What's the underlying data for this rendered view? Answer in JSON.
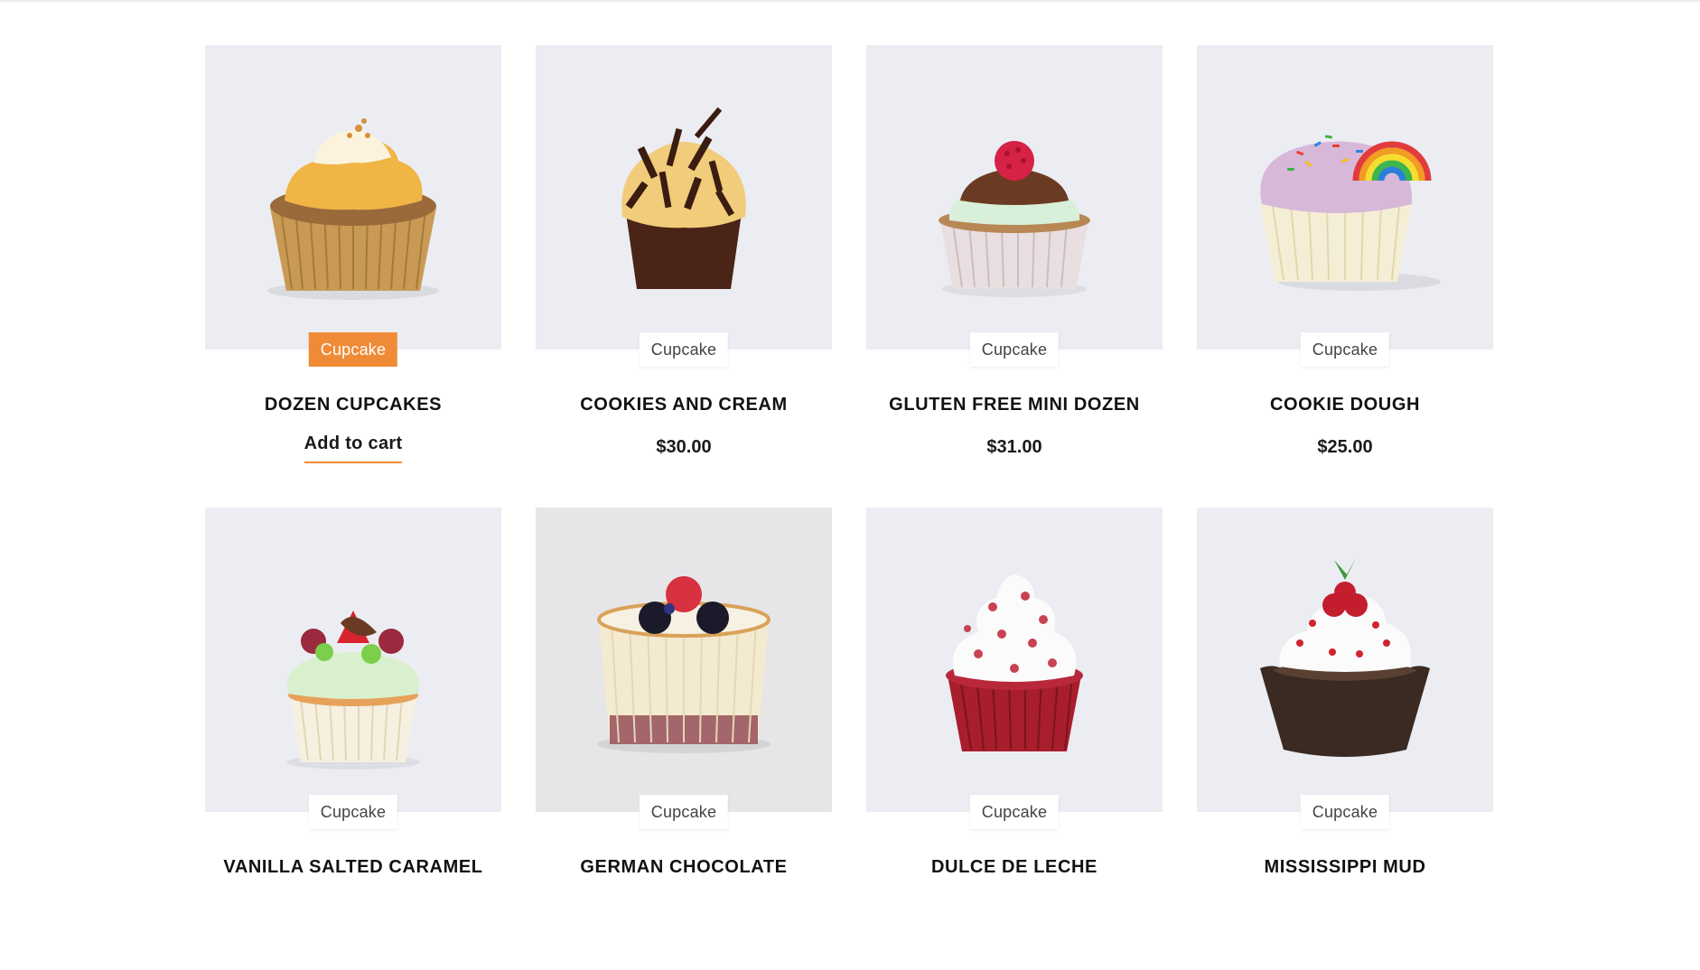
{
  "products": [
    {
      "category": "Cupcake",
      "title": "DOZEN CUPCAKES",
      "action": "Add to cart",
      "image_name": "cupcake-image"
    },
    {
      "category": "Cupcake",
      "title": "COOKIES AND CREAM",
      "price": "$30.00",
      "image_name": "cupcake-image"
    },
    {
      "category": "Cupcake",
      "title": "GLUTEN FREE MINI DOZEN",
      "price": "$31.00",
      "image_name": "cupcake-image"
    },
    {
      "category": "Cupcake",
      "title": "COOKIE DOUGH",
      "price": "$25.00",
      "image_name": "cupcake-image"
    },
    {
      "category": "Cupcake",
      "title": "VANILLA SALTED CARAMEL",
      "image_name": "cupcake-image"
    },
    {
      "category": "Cupcake",
      "title": "GERMAN CHOCOLATE",
      "image_name": "cupcake-image"
    },
    {
      "category": "Cupcake",
      "title": "DULCE DE LECHE",
      "image_name": "cupcake-image"
    },
    {
      "category": "Cupcake",
      "title": "MISSISSIPPI MUD",
      "image_name": "cupcake-image"
    }
  ],
  "colors": {
    "accent": "#ef8b36",
    "image_bg": "#ebedf2",
    "text": "#111111"
  }
}
